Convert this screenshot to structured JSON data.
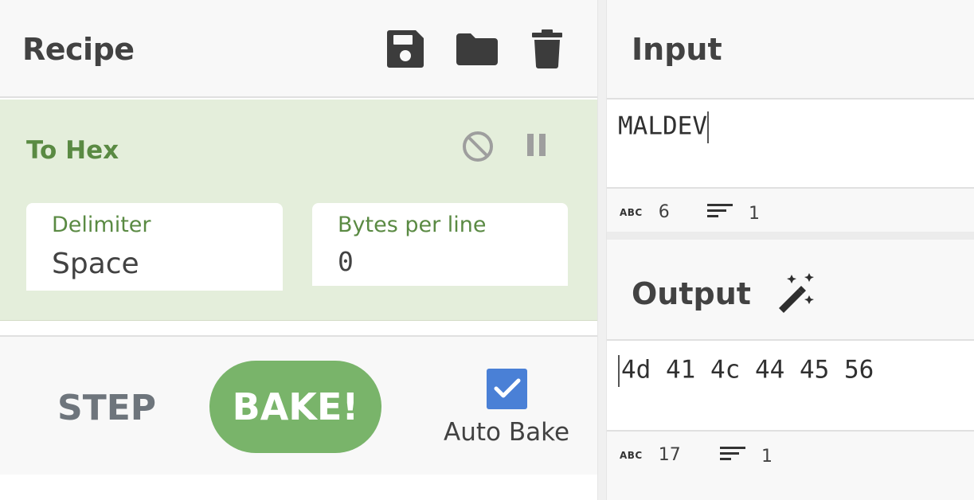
{
  "recipe": {
    "title": "Recipe",
    "icons": [
      "save-icon",
      "folder-icon",
      "trash-icon"
    ],
    "operation": {
      "name": "To Hex",
      "icons": [
        "disable-icon",
        "pause-icon"
      ],
      "args": [
        {
          "label": "Delimiter",
          "value": "Space"
        },
        {
          "label": "Bytes per line",
          "value": "0"
        }
      ]
    },
    "controls": {
      "step_label": "STEP",
      "bake_label": "BAKE!",
      "auto_bake_label": "Auto Bake",
      "auto_bake_checked": true
    }
  },
  "input": {
    "title": "Input",
    "text": "MALDEV",
    "status": {
      "chars": "6",
      "lines": "1"
    }
  },
  "output": {
    "title": "Output",
    "magic_icon": "magic-wand-icon",
    "text": "4d 41 4c 44 45 56",
    "status": {
      "chars": "17",
      "lines": "1"
    }
  },
  "colors": {
    "operation_bg": "#e4eedb",
    "operation_text": "#5a8a43",
    "bake_button": "#79b46a",
    "checkbox": "#4a80d6"
  }
}
